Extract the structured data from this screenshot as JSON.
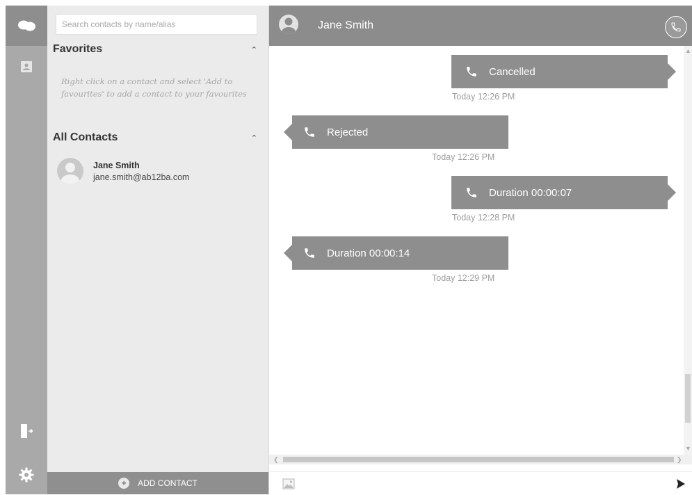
{
  "rail": {
    "icons": [
      "chat-bubbles-icon",
      "contacts-book-icon",
      "logout-door-icon",
      "gear-icon"
    ]
  },
  "contacts": {
    "search_placeholder": "Search contacts by name/alias",
    "favorites_title": "Favorites",
    "favorites_hint": "Right click on a contact and select 'Add to favourites' to add a contact to your favourites",
    "all_contacts_title": "All Contacts",
    "items": [
      {
        "name": "Jane Smith",
        "email": "jane.smith@ab12ba.com"
      }
    ],
    "add_contact_label": "ADD CONTACT"
  },
  "chat": {
    "contact_name": "Jane Smith",
    "messages": [
      {
        "direction": "outgoing",
        "text": "Cancelled",
        "time": "Today 12:26 PM"
      },
      {
        "direction": "incoming",
        "text": "Rejected",
        "time": "Today 12:26 PM"
      },
      {
        "direction": "outgoing",
        "text": "Duration 00:00:07",
        "time": "Today 12:28 PM"
      },
      {
        "direction": "incoming",
        "text": "Duration 00:00:14",
        "time": "Today 12:29 PM"
      }
    ],
    "input_placeholder": ""
  },
  "colors": {
    "header_bg": "#8c8c8c",
    "bubble_bg": "#8e8e8e",
    "rail_bg": "#a9a9a9",
    "panel_bg": "#ebebeb"
  }
}
